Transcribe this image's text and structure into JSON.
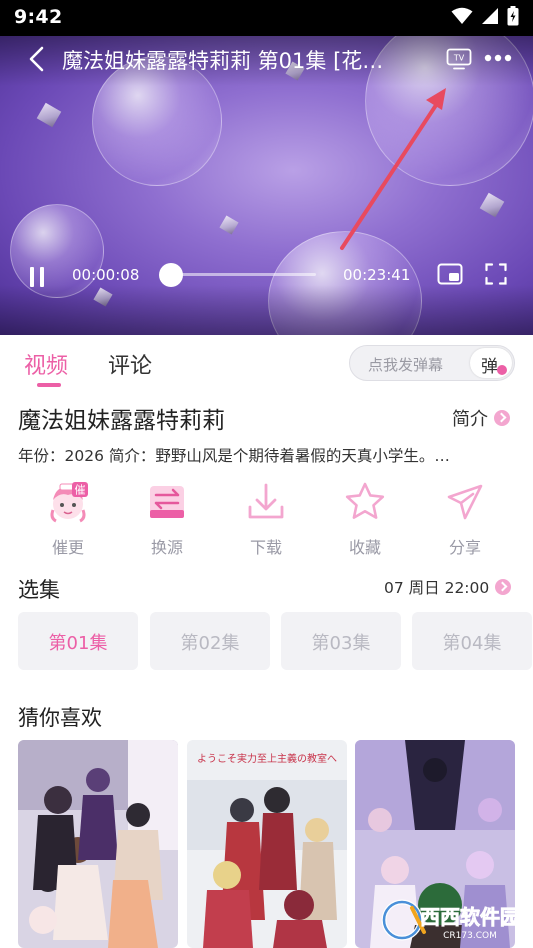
{
  "status_bar": {
    "time": "9:42"
  },
  "player": {
    "title": "魔法姐妹露露特莉莉 第01集 [花…",
    "current_time": "00:00:08",
    "total_time": "00:23:41",
    "progress": 0.006,
    "tv_badge": "TV"
  },
  "tabs": {
    "video": "视频",
    "comments": "评论"
  },
  "danmaku": {
    "placeholder": "点我发弹幕",
    "toggle_label": "弹"
  },
  "show": {
    "title": "魔法姐妹露露特莉莉",
    "intro_link": "简介",
    "meta": "年份：2026   简介：野野山风是个期待着暑假的天真小学生。…"
  },
  "actions": [
    {
      "label": "催更",
      "badge": "催"
    },
    {
      "label": "换源"
    },
    {
      "label": "下载"
    },
    {
      "label": "收藏"
    },
    {
      "label": "分享"
    }
  ],
  "episodes": {
    "title": "选集",
    "schedule": "07 周日 22:00",
    "items": [
      "第01集",
      "第02集",
      "第03集",
      "第04集"
    ],
    "active_index": 0
  },
  "recommendations": {
    "title": "猜你喜欢",
    "cards": [
      {
        "caption": ""
      },
      {
        "caption": "ようこそ実力至上主義の教室へ"
      },
      {
        "caption": ""
      }
    ]
  },
  "watermark": {
    "text": "西西软件园",
    "subtext": "CR173.COM"
  },
  "colors": {
    "accent": "#ec5fa6",
    "muted": "#9a9aa6",
    "annotation_arrow": "#e84a5f"
  }
}
